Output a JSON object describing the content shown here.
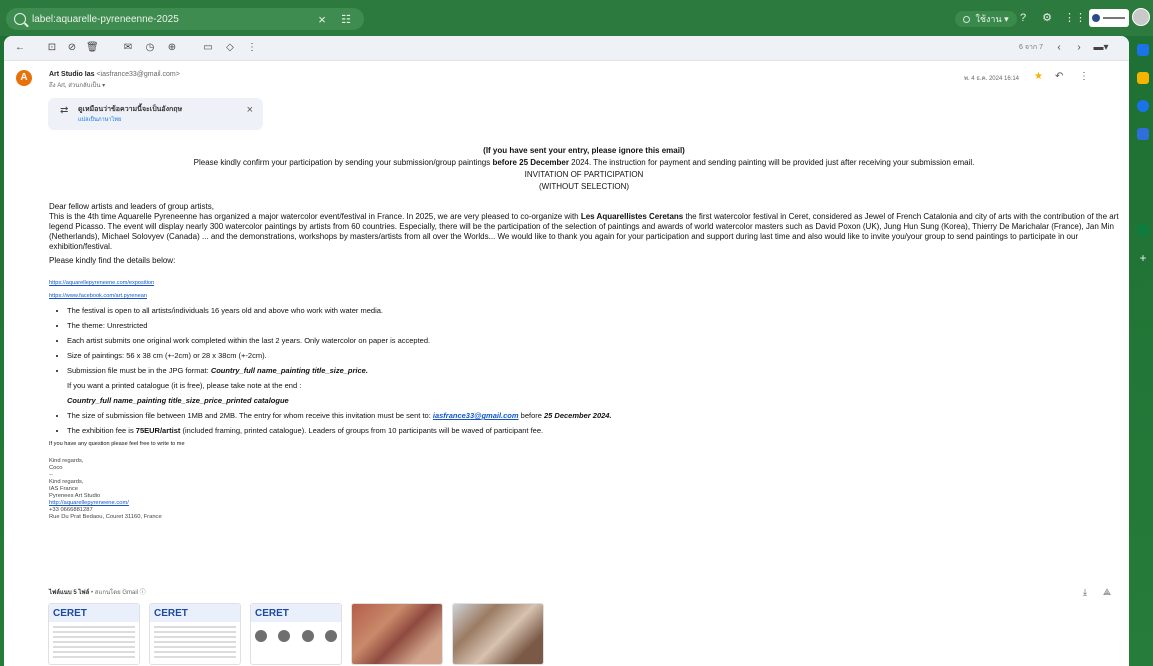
{
  "topbar": {
    "search_query": "label:aquarelle-pyreneenne-2025",
    "status_label": "ใช้งาน"
  },
  "toolbar": {
    "pager": "6 จาก 7"
  },
  "message": {
    "sender_initial": "A",
    "sender_name": "Art Studio Ias",
    "sender_email": "<iasfrance33@gmail.com>",
    "to_line": "ถึง Art, ส่วนกลับเป็น ▾",
    "date": "พ. 4 ธ.ค. 2024 16:14",
    "translate_main": "ดูเหมือนว่าข้อความนี้จะเป็นอังกฤษ",
    "translate_sub": "แปลเป็นภาษาไทย",
    "line1": "(If you have sent your entry, please ignore this email)",
    "line2_a": "Please kindly confirm your participation by sending your submission/group paintings ",
    "line2_b": "before 25 December",
    "line2_c": " 2024. The instruction for payment and sending painting will be provided just after receiving your submission email.",
    "line3": "INVITATION OF PARTICIPATION",
    "line4": "(WITHOUT SELECTION)",
    "dear": "Dear fellow artists and leaders of group artists,",
    "para1_a": "This is the 4th time Aquarelle Pyreneenne has organized a major watercolor event/festival in France. In 2025, we are very pleased to co-organize with ",
    "para1_b": "Les Aquarellistes Ceretans",
    "para1_c": " the first watercolor festival in Ceret, considered as Jewel of French Catalonia and city of arts with the contribution of the art legend Picasso. The event will display nearly 300 watercolor paintings by artists from 60 countries. Especially, there will be the participation of the selection of paintings and awards of world watercolor masters such as David Poxon (UK), Jung Hun Sung (Korea), Thierry De Marichalar (France), Jan Min (Netherlands), Michael Solovyev (Canada) ... and the demonstrations, workshops by masters/artists from all over the Worlds... We would like to thank you again for your participation and support during last time and also would like to invite you/your group to send paintings to participate in our exhibition/festival.",
    "details": "Please kindly find the details below:",
    "link1": "https://aquarellepyreneene.com/exposition",
    "link2": "https://www.facebook.com/art.pyrenean",
    "bullets": {
      "b1": "The festival is open to all artists/individuals 16 years old and above who work with water media.",
      "b2": "The theme: Unrestricted",
      "b3": "Each artist submits one original work completed within the last 2 years. Only watercolor on paper is accepted.",
      "b4": "Size of paintings: 56 x 38 cm (+-2cm) or 28 x 38cm (+-2cm).",
      "b5_a": "Submission file must be in the JPG format: ",
      "b5_b": "Country_full name_painting title_size_price.",
      "b5_c": "If you want a printed catalogue (it is free), please take note at the end :",
      "b5_d": "Country_full name_painting title_size_price_printed catalogue",
      "b6_a": "The size of submission file between 1MB and 2MB. The entry for whom receive this invitation must be sent to: ",
      "b6_b": "iasfrance33@gmail.com",
      "b6_c": " before ",
      "b6_d": "25 December 2024.",
      "b7_a": "The exhibition fee is ",
      "b7_b": "75EUR/artist",
      "b7_c": " (included framing, printed catalogue). Leaders of groups from 10 participants will be waved of participant fee."
    },
    "question": "If you have any question please feel free to write to me",
    "sign1": "Kind regards,",
    "sign2": "Coco",
    "sign3": "--",
    "sign4": "Kind regards,",
    "sign5": "IAS France",
    "sign6": "Pyrenees Art Studio",
    "sign7": "http://aquarellepyreneene.com/",
    "sign8": "+33 0666881287",
    "sign9": "Rue Du Prat Bedaou, Couret 31160, France"
  },
  "attachments": {
    "title": "ไฟล์แนบ 5 ไฟล์",
    "scanned": "• สแกนโดย Gmail ⓘ",
    "thumb_text": "CERET"
  }
}
